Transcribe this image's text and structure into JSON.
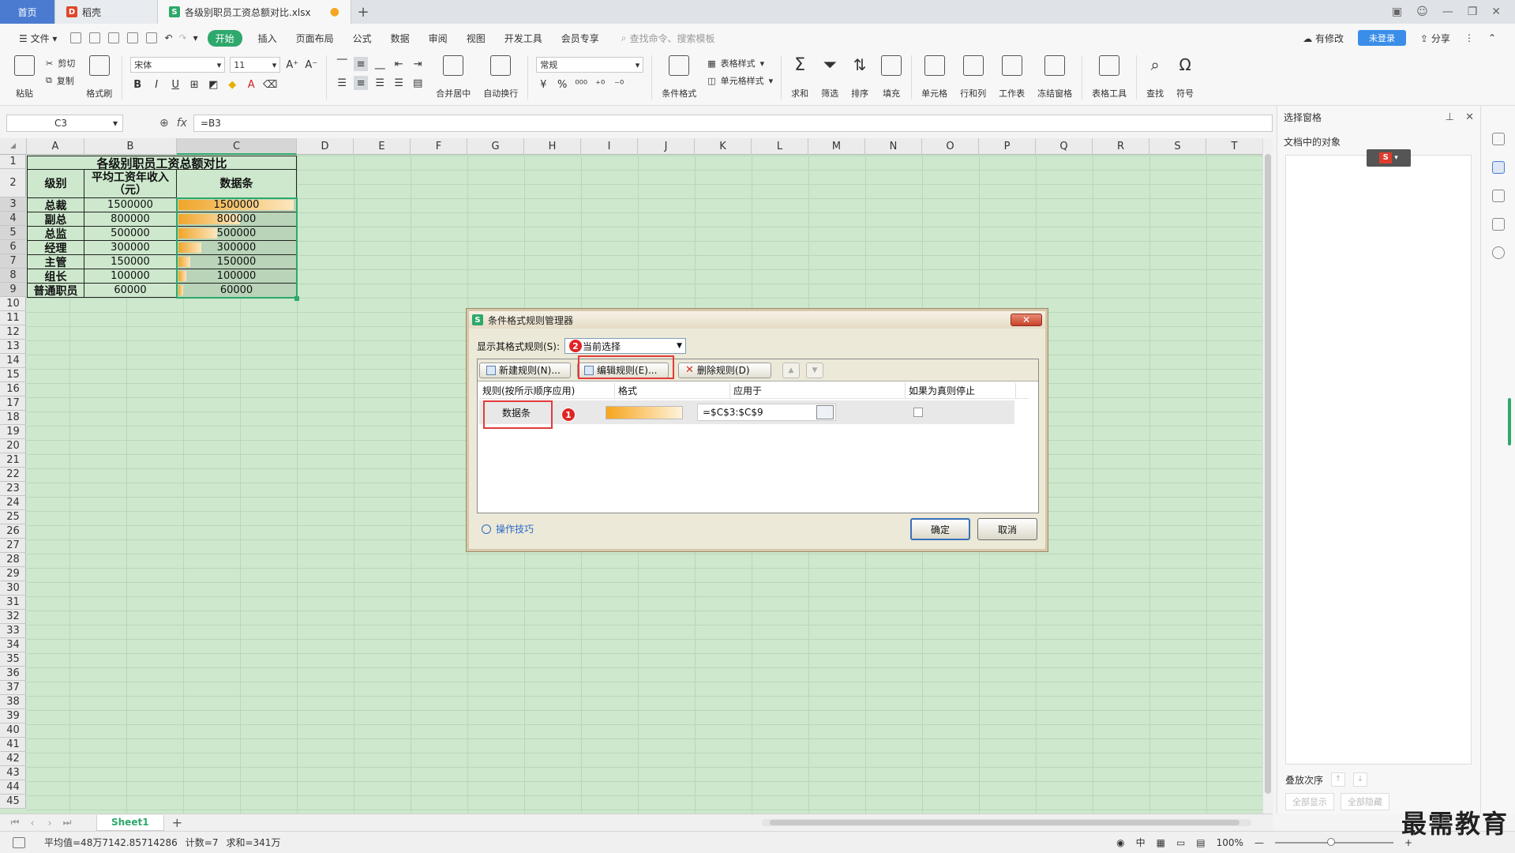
{
  "tabs": {
    "home": "首页",
    "doc": "稻壳",
    "active": "各级别职员工资总额对比.xlsx"
  },
  "menu": {
    "file": "文件",
    "items": [
      "开始",
      "插入",
      "页面布局",
      "公式",
      "数据",
      "审阅",
      "视图",
      "开发工具",
      "会员专享"
    ],
    "search_placeholder": "查找命令、搜索模板",
    "unsaved": "有修改",
    "login": "未登录",
    "share": "分享"
  },
  "ribbon": {
    "paste": "粘贴",
    "cut": "剪切",
    "copy": "复制",
    "format_painter": "格式刷",
    "font_name": "宋体",
    "font_size": "11",
    "merge_center": "合并居中",
    "wrap_text": "自动换行",
    "number_format": "常规",
    "conditional_format": "条件格式",
    "table_style": "表格样式",
    "cell_style": "单元格样式",
    "sum": "求和",
    "filter": "筛选",
    "sort": "排序",
    "fill": "填充",
    "cell": "单元格",
    "row_col": "行和列",
    "worksheet": "工作表",
    "freeze": "冻结窗格",
    "table_tools": "表格工具",
    "find": "查找",
    "symbol": "符号"
  },
  "formula_bar": {
    "cell_ref": "C3",
    "fx": "fx",
    "formula": "=B3"
  },
  "sheet": {
    "columns": [
      "A",
      "B",
      "C",
      "D",
      "E",
      "F",
      "G",
      "H",
      "I",
      "J",
      "K",
      "L",
      "M",
      "N",
      "O",
      "P",
      "Q",
      "R",
      "S",
      "T"
    ],
    "title": "各级别职员工资总额对比",
    "header_level": "级别",
    "header_income": "平均工资年收入（元）",
    "header_bar": "数据条",
    "rows": [
      {
        "level": "总裁",
        "income": "1500000",
        "bar": "1500000",
        "ratio": 1.0
      },
      {
        "level": "副总",
        "income": "800000",
        "bar": "800000",
        "ratio": 0.533
      },
      {
        "level": "总监",
        "income": "500000",
        "bar": "500000",
        "ratio": 0.333
      },
      {
        "level": "经理",
        "income": "300000",
        "bar": "300000",
        "ratio": 0.2
      },
      {
        "level": "主管",
        "income": "150000",
        "bar": "150000",
        "ratio": 0.1
      },
      {
        "level": "组长",
        "income": "100000",
        "bar": "100000",
        "ratio": 0.067
      },
      {
        "level": "普通职员",
        "income": "60000",
        "bar": "60000",
        "ratio": 0.04
      }
    ],
    "sheet_tab": "Sheet1"
  },
  "status": {
    "average": "平均值=48万7142.85714286",
    "count": "计数=7",
    "sum": "求和=341万",
    "zoom": "100%"
  },
  "task_pane": {
    "title": "选择窗格",
    "objects_label": "文档中的对象",
    "order_label": "叠放次序",
    "show_all": "全部显示",
    "hide_all": "全部隐藏"
  },
  "dialog": {
    "title": "条件格式规则管理器",
    "show_rules_label": "显示其格式规则(S):",
    "show_rules_value": "当前选择",
    "new_rule": "新建规则(N)...",
    "edit_rule": "编辑规则(E)...",
    "delete_rule": "删除规则(D)",
    "col_rule": "规则(按所示顺序应用)",
    "col_format": "格式",
    "col_applies": "应用于",
    "col_stop": "如果为真则停止",
    "rule_name": "数据条",
    "applies_to": "=$C$3:$C$9",
    "tips": "操作技巧",
    "ok": "确定",
    "cancel": "取消",
    "anno1": "1",
    "anno2": "2"
  },
  "watermark": "最需教育",
  "colors": {
    "accent": "#2ea86b",
    "sheet_bg": "#cde8cd",
    "bar_start": "#f0a52a",
    "annotation": "#e23b3b"
  }
}
